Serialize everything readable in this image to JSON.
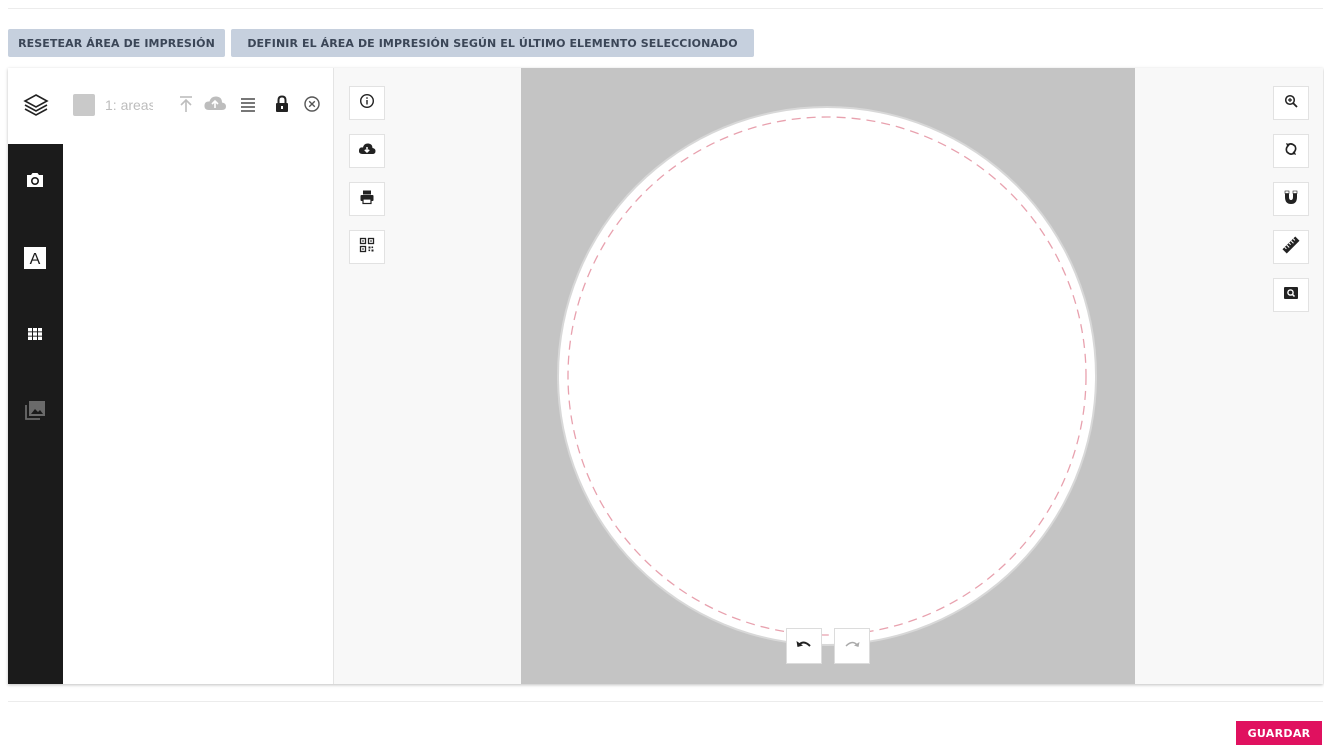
{
  "toolbar": {
    "reset_label": "RESETEAR ÁREA DE IMPRESIÓN",
    "define_label": "DEFINIR EL ÁREA DE IMPRESIÓN SEGÚN EL ÚLTIMO ELEMENTO SELECCIONADO"
  },
  "layers": {
    "icon": "layers-icon",
    "items": [
      {
        "name": "1: areas",
        "swatch_color": "#c9c9c9",
        "actions": [
          "move-to-top-icon",
          "cloud-icon",
          "align-icon",
          "lock-icon",
          "close-circle-icon"
        ]
      }
    ]
  },
  "rail": {
    "items": [
      "camera-icon",
      "text-icon",
      "grid-icon",
      "image-gallery-icon"
    ]
  },
  "canvas_tools": [
    "info-icon",
    "cloud-download-icon",
    "print-icon",
    "qr-code-icon"
  ],
  "right_tools": [
    "zoom-in-icon",
    "rotate-icon",
    "magnet-icon",
    "ruler-icon",
    "zoom-box-icon"
  ],
  "history": {
    "undo": "undo-icon",
    "redo": "redo-icon"
  },
  "colors": {
    "rail_bg": "#1b1b1b",
    "canvas_bg": "#c4c4c4",
    "guide_dash": "#e8a1ae",
    "save_bg": "#e0115f",
    "top_button_bg": "#c6d0de"
  },
  "footer": {
    "save_label": "GUARDAR"
  }
}
